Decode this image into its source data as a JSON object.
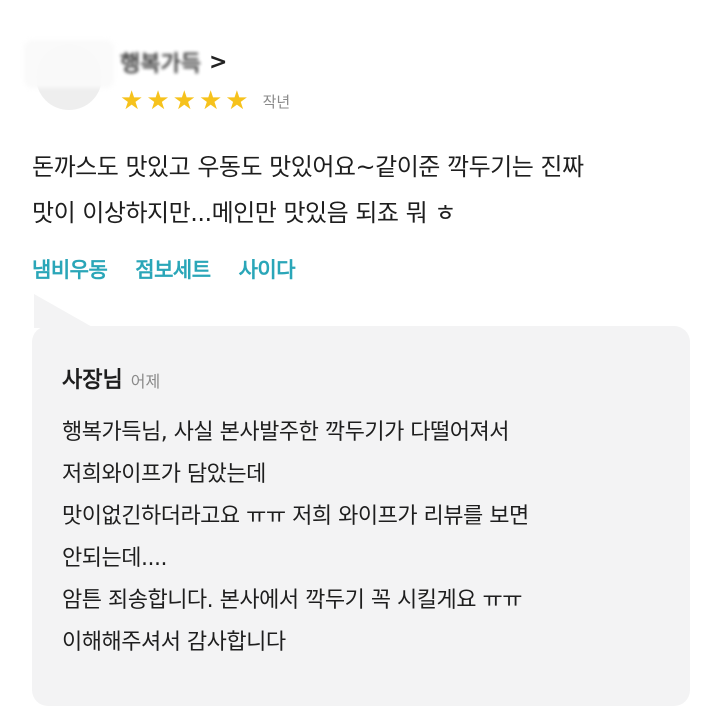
{
  "review": {
    "username": "행복가득",
    "chevron": ">",
    "rating": 5,
    "stars": [
      "★",
      "★",
      "★",
      "★",
      "★"
    ],
    "date": "작년",
    "text_lines": [
      "돈까스도 맛있고 우동도 맛있어요~같이준 깍두기는 진짜",
      "맛이 이상하지만...메인만 맛있음 되죠 뭐 ㅎ"
    ],
    "tags": [
      "냄비우동",
      "점보세트",
      "사이다"
    ]
  },
  "reply": {
    "author": "사장님",
    "date": "어제",
    "lines": [
      "행복가득님, 사실 본사발주한 깍두기가 다떨어져서",
      "저희와이프가 담았는데",
      "맛이없긴하더라고요 ㅠㅠ 저희 와이프가 리뷰를 보면",
      "안되는데....",
      "암튼 죄송합니다. 본사에서 깍두기 꼭 시킬게요 ㅠㅠ",
      "이해해주셔서 감사합니다"
    ]
  },
  "colors": {
    "star": "#f6c21c",
    "tag": "#2aa6b8",
    "reply_background": "#f3f3f4",
    "muted_text": "#8a8a8a"
  }
}
